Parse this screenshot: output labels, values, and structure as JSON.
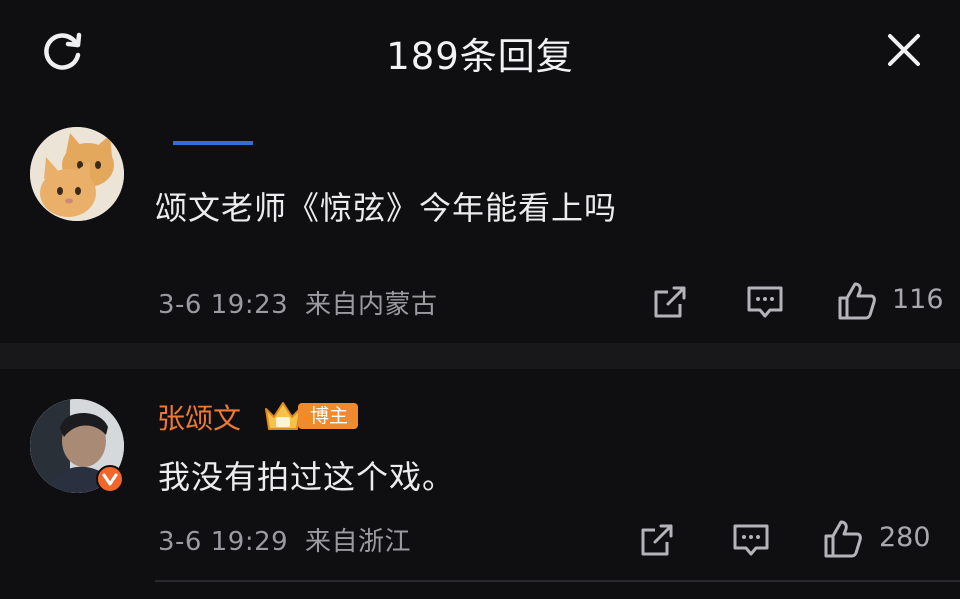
{
  "header": {
    "title": "189条回复"
  },
  "comments": [
    {
      "username": "",
      "content": "颂文老师《惊弦》今年能看上吗",
      "time": "3-6 19:23",
      "location": "来自内蒙古",
      "likes": "116",
      "avatar": "cat-avatar"
    },
    {
      "username": "张颂文",
      "badge": "博主",
      "content": "我没有拍过这个戏。",
      "time": "3-6 19:29",
      "location": "来自浙江",
      "likes": "280",
      "avatar": "man-avatar",
      "verified": true
    }
  ],
  "colors": {
    "background": "#0f0f12",
    "author_name": "#ee7a32",
    "badge": "#ef8b2c",
    "verified": "#f2662a"
  },
  "icons": [
    "refresh-icon",
    "close-icon",
    "share-icon",
    "comment-icon",
    "like-icon",
    "crown-icon",
    "verified-icon"
  ]
}
